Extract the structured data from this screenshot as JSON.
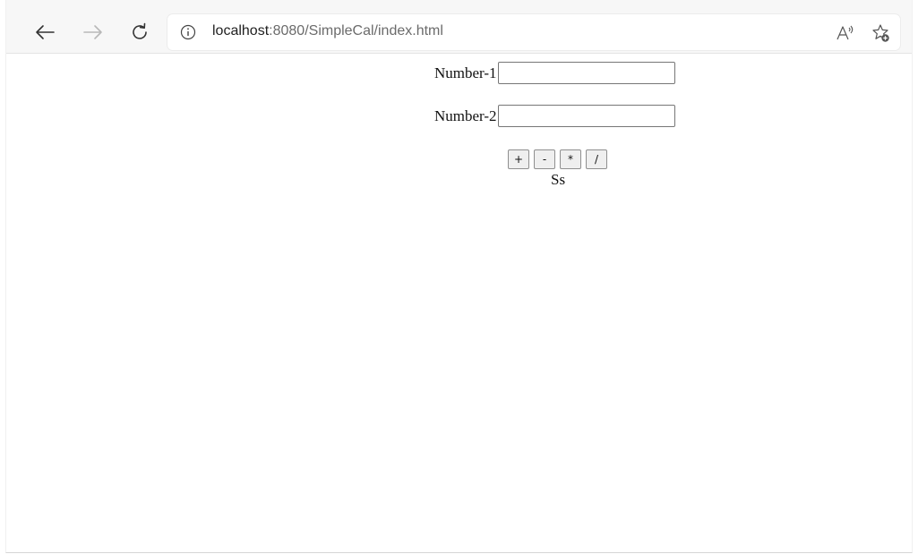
{
  "browser": {
    "url_host": "localhost",
    "url_rest": ":8080/SimpleCal/index.html"
  },
  "form": {
    "number1_label": "Number-1",
    "number1_value": "",
    "number2_label": "Number-2",
    "number2_value": "",
    "buttons": [
      "+",
      "-",
      "*",
      "/"
    ],
    "result_text": "Ss"
  }
}
